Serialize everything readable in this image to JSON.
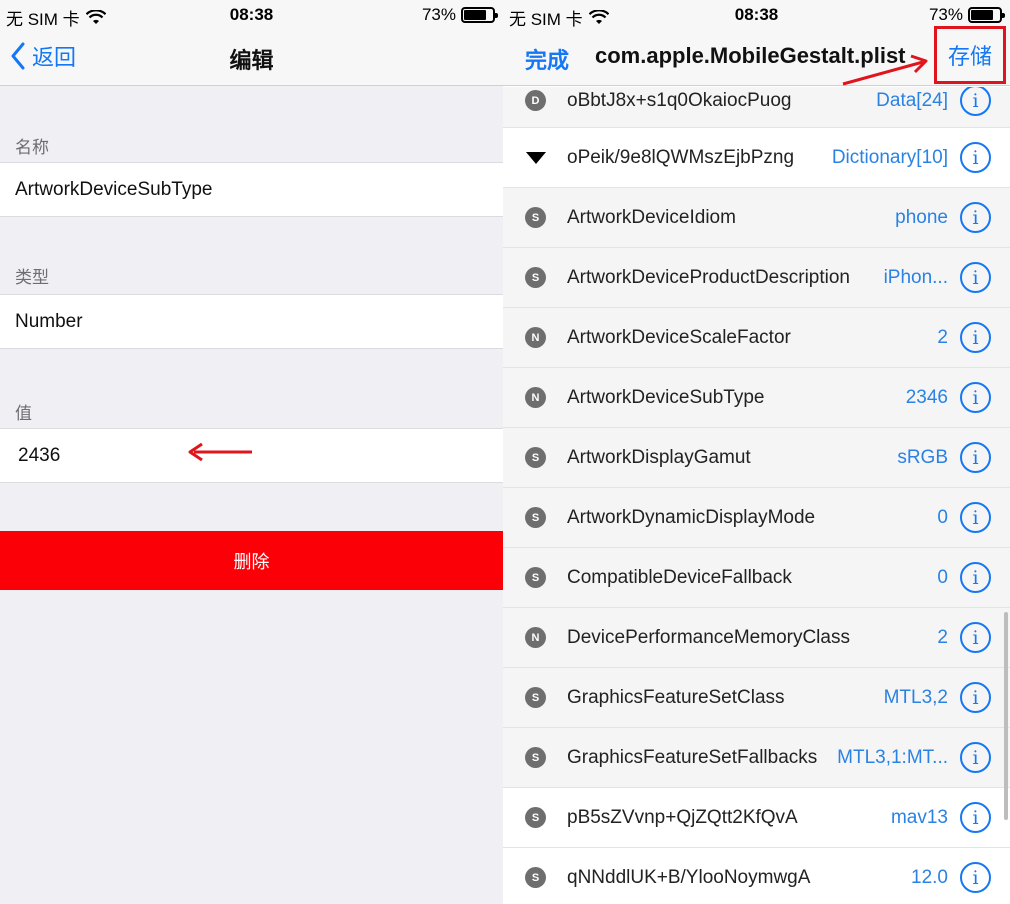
{
  "left": {
    "status": {
      "carrier": "无 SIM 卡",
      "time": "08:38",
      "battery": "73%"
    },
    "nav": {
      "back_label": "返回",
      "title": "编辑"
    },
    "fields": {
      "name_label": "名称",
      "name_value": "ArtworkDeviceSubType",
      "type_label": "类型",
      "type_value": "Number",
      "value_label": "值",
      "value_value": "2436"
    },
    "delete_label": "删除"
  },
  "right": {
    "status": {
      "carrier": "无 SIM 卡",
      "time": "08:38",
      "battery": "73%"
    },
    "nav": {
      "done_label": "完成",
      "title": "com.apple.MobileGestalt.plist",
      "save_label": "存储"
    },
    "rows": [
      {
        "badge": "D",
        "key": "oBbtJ8x+s1q0OkaiocPuog",
        "value": "Data[24]"
      },
      {
        "badge": "▼",
        "key": "oPeik/9e8lQWMszEjbPzng",
        "value": "Dictionary[10]"
      },
      {
        "badge": "S",
        "key": "ArtworkDeviceIdiom",
        "value": "phone"
      },
      {
        "badge": "S",
        "key": "ArtworkDeviceProductDescription",
        "value": "iPhon..."
      },
      {
        "badge": "N",
        "key": "ArtworkDeviceScaleFactor",
        "value": "2"
      },
      {
        "badge": "N",
        "key": "ArtworkDeviceSubType",
        "value": "2346"
      },
      {
        "badge": "S",
        "key": "ArtworkDisplayGamut",
        "value": "sRGB"
      },
      {
        "badge": "S",
        "key": "ArtworkDynamicDisplayMode",
        "value": "0"
      },
      {
        "badge": "S",
        "key": "CompatibleDeviceFallback",
        "value": "0"
      },
      {
        "badge": "N",
        "key": "DevicePerformanceMemoryClass",
        "value": "2"
      },
      {
        "badge": "S",
        "key": "GraphicsFeatureSetClass",
        "value": "MTL3,2"
      },
      {
        "badge": "S",
        "key": "GraphicsFeatureSetFallbacks",
        "value": "MTL3,1:MT..."
      },
      {
        "badge": "S",
        "key": "pB5sZVvnp+QjZQtt2KfQvA",
        "value": "mav13"
      },
      {
        "badge": "S",
        "key": "qNNddlUK+B/YlooNoymwgA",
        "value": "12.0"
      }
    ],
    "info_glyph": "i"
  },
  "icons": {
    "back": "chevron-left-icon",
    "wifi": "wifi-icon",
    "battery": "battery-icon",
    "info": "info-circle-icon",
    "annotation": "red-arrow-icon"
  },
  "colors": {
    "accent": "#1478f5",
    "value_text": "#2a82e4",
    "delete_bg": "#fb0007",
    "highlight_box": "#e0141c",
    "badge": "#6e6e6e"
  }
}
